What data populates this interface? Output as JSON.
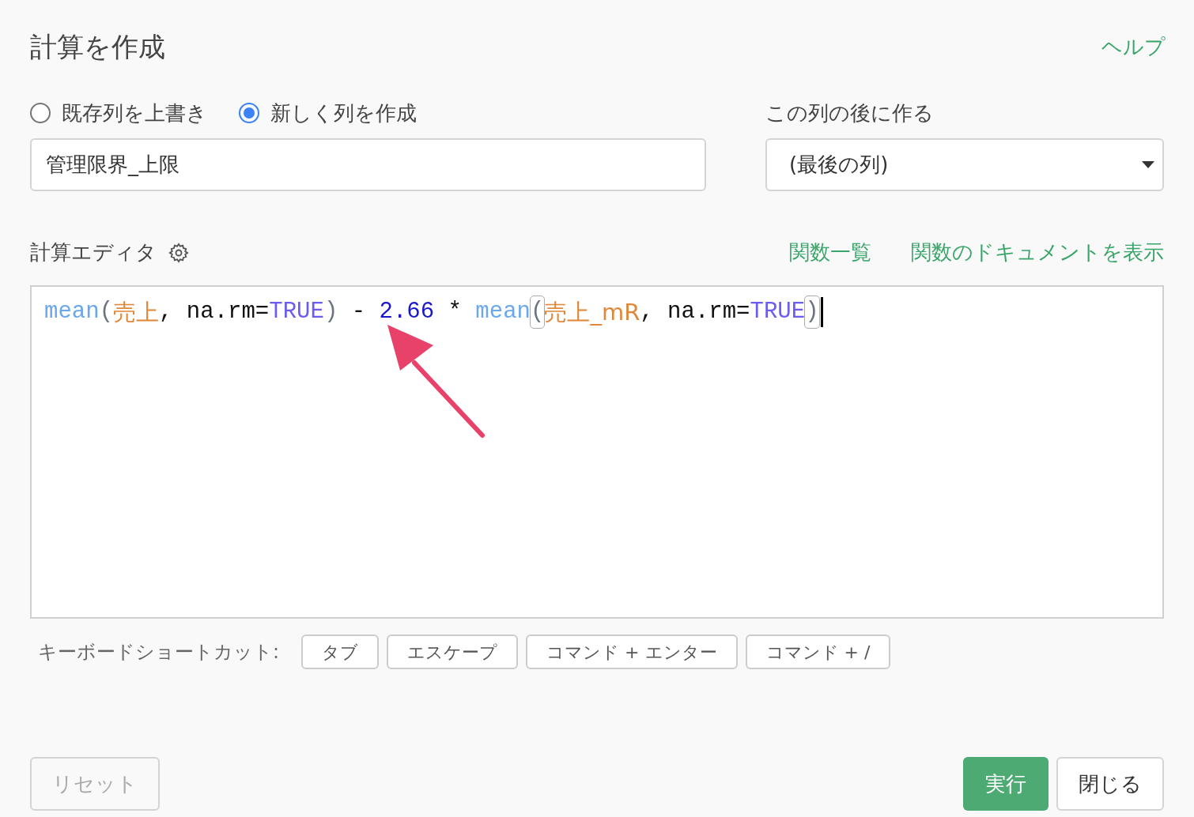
{
  "title": "計算を作成",
  "help_link": "ヘルプ",
  "mode_options": [
    {
      "label": "既存列を上書き",
      "selected": false
    },
    {
      "label": "新しく列を作成",
      "selected": true
    }
  ],
  "column_name": {
    "value": "管理限界_上限"
  },
  "position": {
    "label": "この列の後に作る",
    "value": "(最後の列)"
  },
  "editor": {
    "label": "計算エディタ",
    "links": [
      "関数一覧",
      "関数のドキュメントを表示"
    ],
    "tokens": [
      {
        "kind": "function",
        "text": "mean"
      },
      {
        "kind": "paren",
        "text": "("
      },
      {
        "kind": "column",
        "text": "売上"
      },
      {
        "kind": "plain",
        "text": ", na.rm="
      },
      {
        "kind": "constant",
        "text": "TRUE"
      },
      {
        "kind": "paren",
        "text": ")"
      },
      {
        "kind": "plain",
        "text": " - "
      },
      {
        "kind": "number",
        "text": "2.66"
      },
      {
        "kind": "plain",
        "text": " * "
      },
      {
        "kind": "function",
        "text": "mean"
      },
      {
        "kind": "matched",
        "text": "("
      },
      {
        "kind": "column",
        "text": "売上_mR"
      },
      {
        "kind": "plain",
        "text": ", na.rm="
      },
      {
        "kind": "constant",
        "text": "TRUE"
      },
      {
        "kind": "matched",
        "text": ")"
      }
    ]
  },
  "shortcuts": {
    "label": "キーボードショートカット:",
    "keys": [
      "タブ",
      "エスケープ",
      "コマンド + エンター",
      "コマンド + /"
    ]
  },
  "buttons": {
    "reset": "リセット",
    "run": "実行",
    "close": "閉じる"
  }
}
